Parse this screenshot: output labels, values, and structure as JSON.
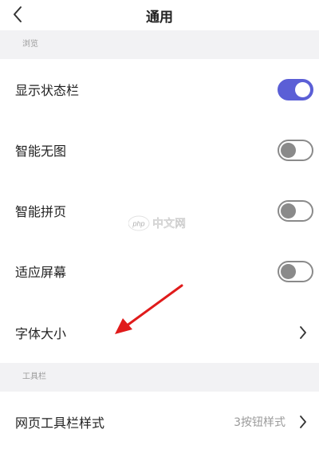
{
  "header": {
    "title": "通用"
  },
  "sections": [
    {
      "header": "浏览"
    },
    {
      "header": "工具栏"
    }
  ],
  "rows": {
    "status_bar": {
      "label": "显示状态栏",
      "toggle": "on"
    },
    "smart_no_image": {
      "label": "智能无图",
      "toggle": "off"
    },
    "smart_page_join": {
      "label": "智能拼页",
      "toggle": "off"
    },
    "fit_screen": {
      "label": "适应屏幕",
      "toggle": "off"
    },
    "font_size": {
      "label": "字体大小"
    },
    "toolbar_style": {
      "label": "网页工具栏样式",
      "value": "3按钮样式"
    }
  },
  "watermark": {
    "text": "php 中文网"
  },
  "colors": {
    "toggle_on": "#5b5fd6",
    "toggle_off": "#8a8a8a",
    "arrow": "#e01b1b",
    "section_bg": "#f2f2f4"
  },
  "icons": {
    "back": "chevron-left-icon",
    "row_arrow": "chevron-right-icon"
  }
}
